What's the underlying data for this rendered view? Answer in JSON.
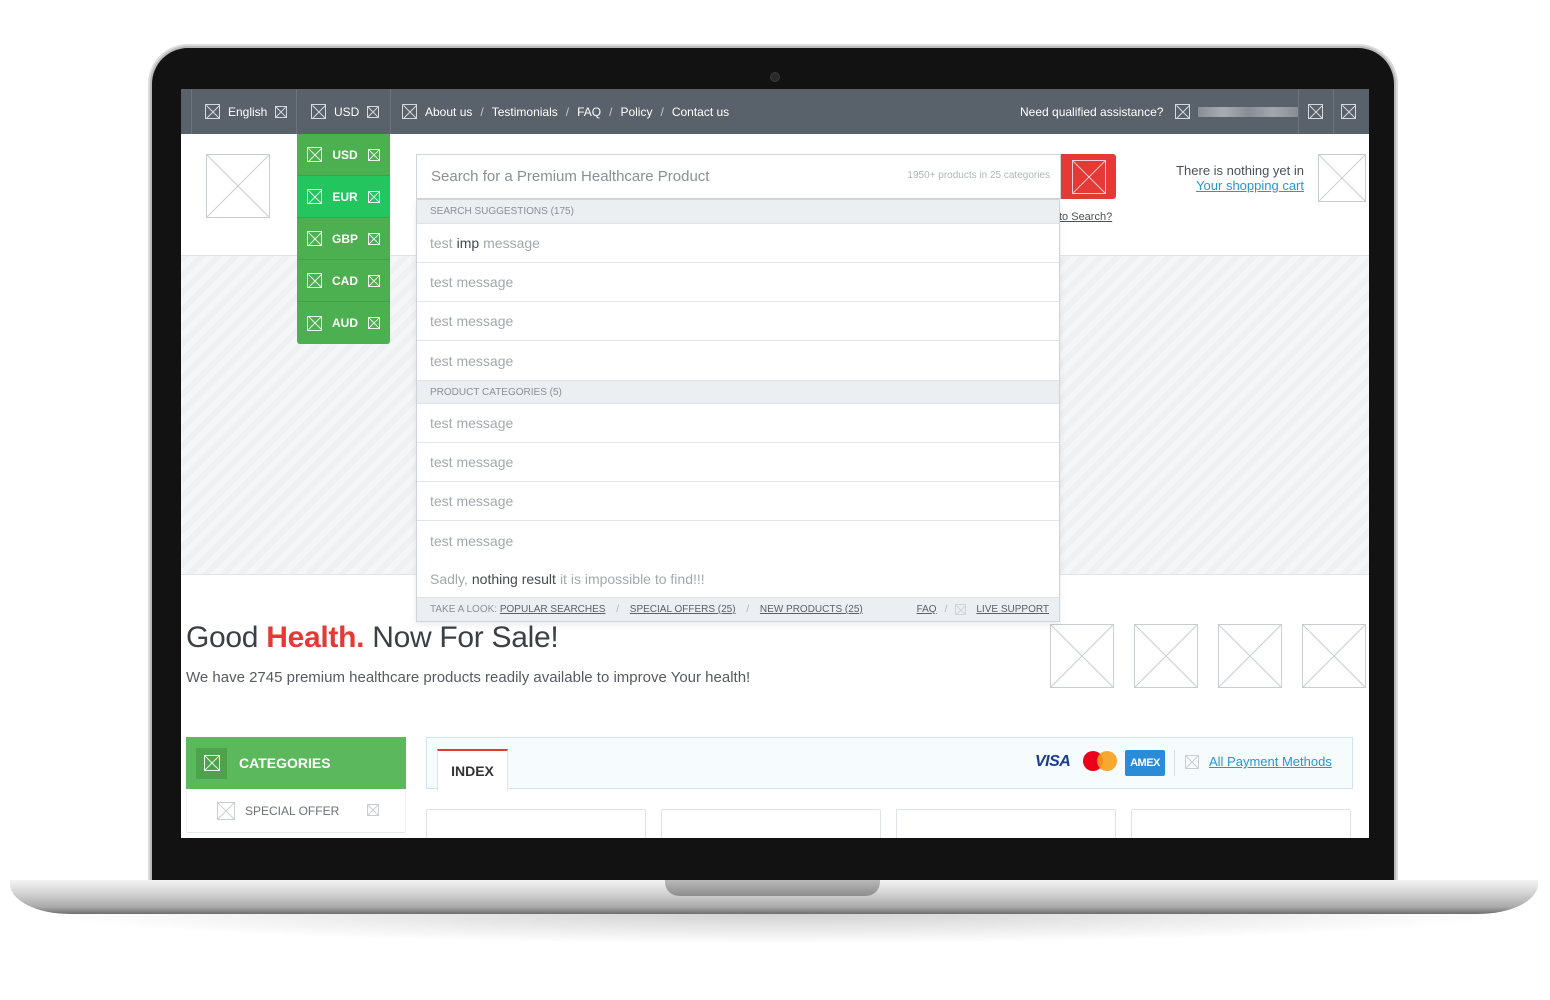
{
  "topbar": {
    "language": "English",
    "currency": "USD",
    "nav": [
      "About us",
      "Testimonials",
      "FAQ",
      "Policy",
      "Contact us"
    ],
    "assistance": "Need qualified assistance?"
  },
  "currency_dropdown": [
    {
      "code": "USD",
      "active": false
    },
    {
      "code": "EUR",
      "active": true
    },
    {
      "code": "GBP",
      "active": false
    },
    {
      "code": "CAD",
      "active": false
    },
    {
      "code": "AUD",
      "active": false
    }
  ],
  "search": {
    "placeholder": "Search for a Premium Healthcare Product",
    "count": "1950+ products in 25 categories",
    "howto": "to Search?"
  },
  "cart": {
    "line1": "There is nothing yet in",
    "link": "Your shopping cart"
  },
  "suggestions": {
    "group1_title": "SEARCH SUGGESTIONS (175)",
    "first_row": {
      "pre": "test",
      "highlight": "imp",
      "post": "message"
    },
    "group1_rows": [
      "test message",
      "test message",
      "test message"
    ],
    "group2_title": "PRODUCT CATEGORIES (5)",
    "group2_rows": [
      "test message",
      "test message",
      "test message",
      "test message"
    ],
    "nothing": {
      "pre": "Sadly,",
      "highlight": "nothing result",
      "post": "it is impossible to find!!!"
    },
    "footer": {
      "take": "TAKE A LOOK:",
      "popular": "POPULAR SEARCHES",
      "special": "SPECIAL OFFERS (25)",
      "new": "NEW PRODUCTS (25)",
      "faq": "FAQ",
      "live": "LIVE SUPPORT"
    }
  },
  "hero": {
    "title_pre": "Good",
    "title_accent": "Health.",
    "title_post": "Now For Sale!",
    "subtitle": "We have 2745 premium healthcare products readily available to improve Your health!"
  },
  "categories": {
    "title": "CATEGORIES",
    "first_item": "SPECIAL OFFER"
  },
  "index_panel": {
    "tab": "INDEX",
    "visa": "VISA",
    "amex": "AMEX",
    "all_payments": "All Payment Methods"
  },
  "colors": {
    "topbar": "#59616a",
    "green": "#4caf50",
    "active_green": "#22c55e",
    "red_accent": "#e53935",
    "link_blue": "#1e9ad6"
  }
}
